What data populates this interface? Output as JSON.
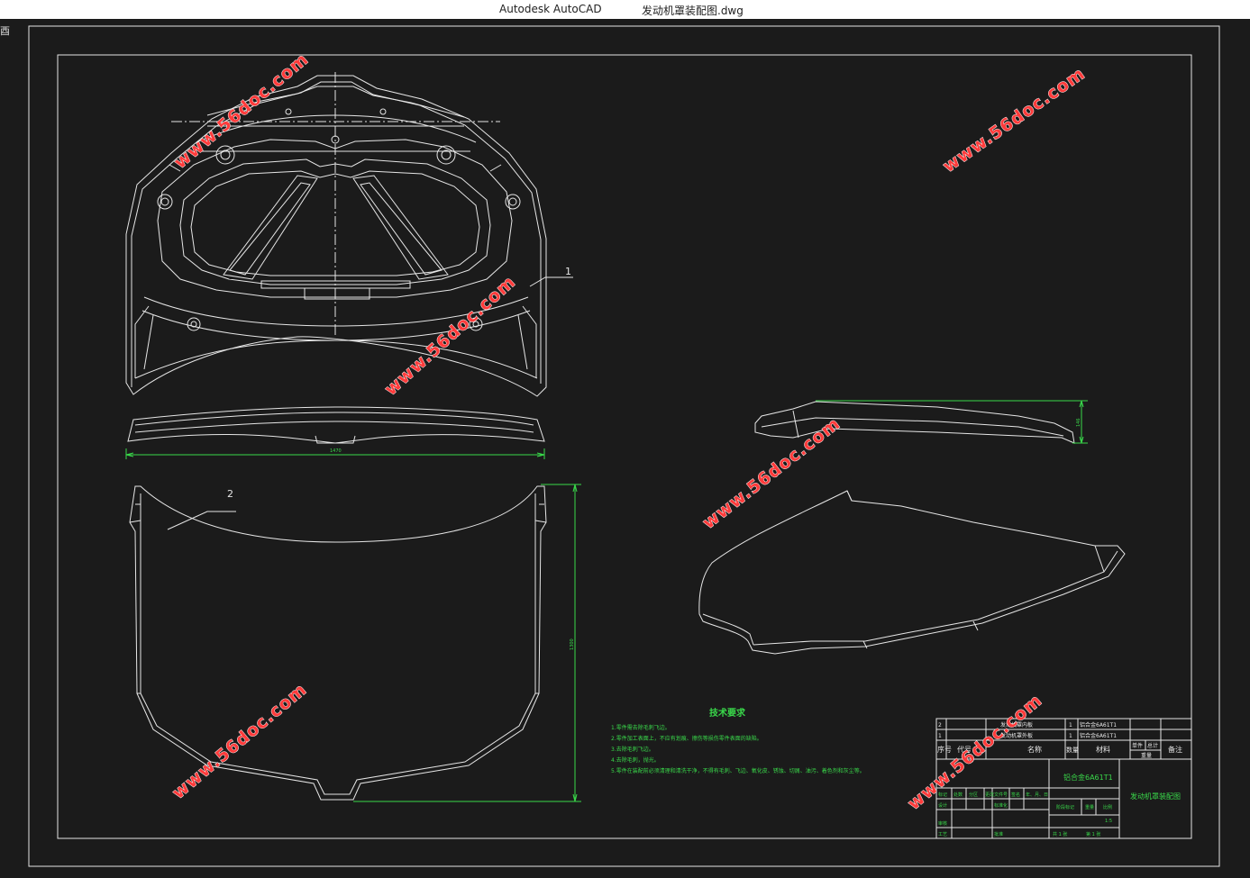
{
  "window": {
    "app_name": "Autodesk AutoCAD",
    "file_name": "发动机罩装配图.dwg",
    "corner_glyph": "酉"
  },
  "colors": {
    "background": "#1b1b1b",
    "lines": "#ffffff",
    "dimensions": "#39d84a",
    "watermark": "#ff3b3b"
  },
  "drawing": {
    "balloon_1": "1",
    "balloon_2": "2",
    "dim_width": "1470",
    "dim_length": "1300",
    "dim_height": "146"
  },
  "watermark_text": "www.56doc.com",
  "tech_requirements": {
    "title": "技术要求",
    "items": [
      "1.零件需去除毛刺飞边。",
      "2.零件加工表面上，不应有划痕、擦伤等损伤零件表面的缺陷。",
      "3.去除毛刺飞边。",
      "4.去除毛刺，抛光。",
      "5.零件在装配前必须清理和清洗干净，不得有毛刺、飞边、氧化皮、锈蚀、切屑、油污、着色剂和灰尘等。"
    ]
  },
  "title_block": {
    "bom_rows": [
      {
        "no": "2",
        "name": "发动机罩内板",
        "qty": "1",
        "material": "铝合金6A61T1"
      },
      {
        "no": "1",
        "name": "发动机罩外板",
        "qty": "1",
        "material": "铝合金6A61T1"
      }
    ],
    "headers": {
      "no": "序号",
      "code": "代号",
      "name": "名称",
      "qty": "数量",
      "material": "材料",
      "unit_weight": "单件",
      "total_weight": "总计",
      "weight": "重量",
      "note": "备注"
    },
    "material_mark": "铝合金6A61T1",
    "drawing_title": "发动机罩装配图",
    "mark_row": [
      "标记",
      "处数",
      "分区",
      "更改文件号",
      "签名",
      "年、月、日"
    ],
    "designer": "设计",
    "standardization": "标准化",
    "stage_mark": "阶段标记",
    "weight_label": "重量",
    "scale_label": "比例",
    "scale": "1:5",
    "checker": "审核",
    "process": "工艺",
    "approve": "批准",
    "sheets": "共 1 张",
    "sheet_no": "第 1 张"
  }
}
